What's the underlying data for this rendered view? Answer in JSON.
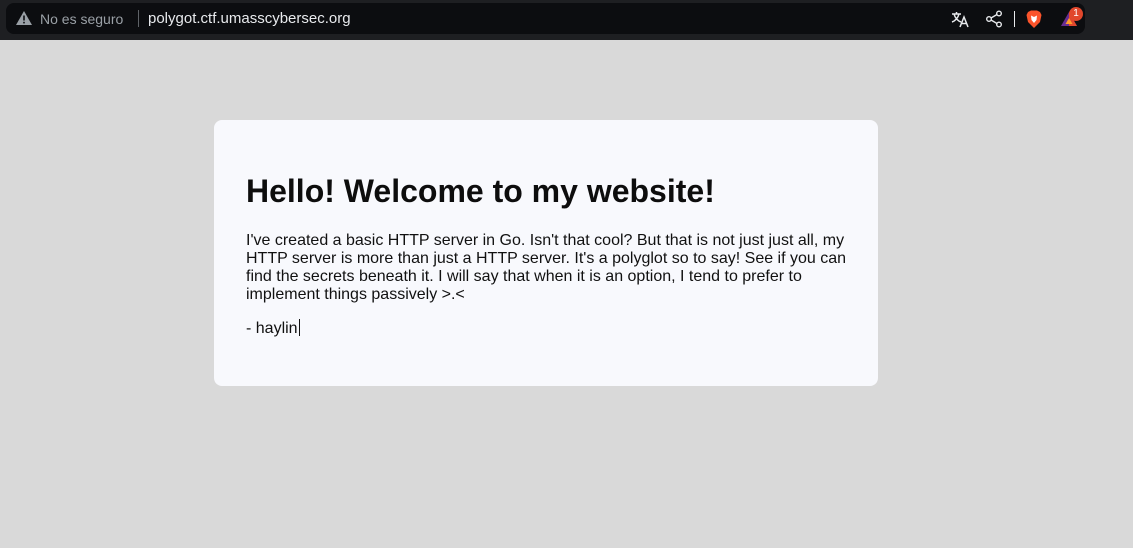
{
  "browser": {
    "security_label": "No es seguro",
    "url": "polygot.ctf.umasscybersec.org",
    "rewards_badge_count": "1",
    "icons": [
      "warning-icon",
      "translate-icon",
      "share-icon",
      "brave-shield-icon",
      "brave-rewards-icon"
    ]
  },
  "page": {
    "title": "Hello! Welcome to my website!",
    "intro": "I've created a basic HTTP server in Go. Isn't that cool? But that is not just just all, my HTTP server is more than just a HTTP server. It's a polyglot so to say! See if you can find the secrets beneath it. I will say that when it is an option, I tend to prefer to implement things passively >.<",
    "signature": "- haylin"
  },
  "colors": {
    "page_background": "#d9d9d9",
    "card_background": "#f8f9fd",
    "toolbar_background": "#1e1f22",
    "omnibox_background": "#0c0d10",
    "brave_orange": "#fb542b",
    "badge_red": "#e1472c"
  }
}
